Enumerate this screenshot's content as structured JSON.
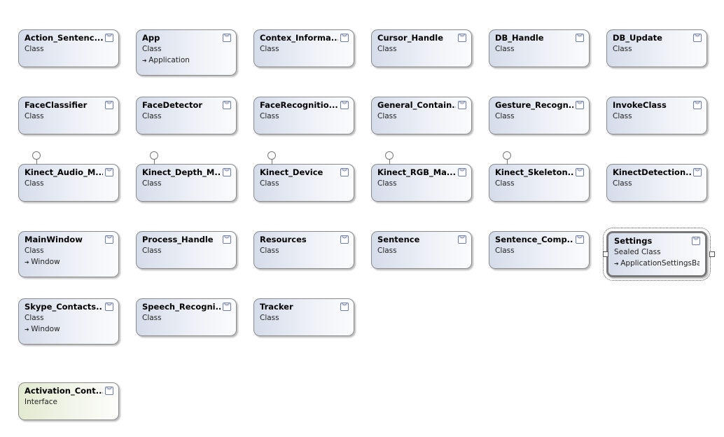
{
  "toggle_icon": "double-chevron-down-icon",
  "arrow_icon": "inheritance-arrow-icon",
  "rows": [
    [
      {
        "name": "Action_Sentenc...",
        "kind": "Class"
      },
      {
        "name": "App",
        "kind": "Class",
        "base": "Application"
      },
      {
        "name": "Contex_Informa...",
        "kind": "Class"
      },
      {
        "name": "Cursor_Handle",
        "kind": "Class"
      },
      {
        "name": "DB_Handle",
        "kind": "Class"
      },
      {
        "name": "DB_Update",
        "kind": "Class"
      }
    ],
    [
      {
        "name": "FaceClassifier",
        "kind": "Class"
      },
      {
        "name": "FaceDetector",
        "kind": "Class"
      },
      {
        "name": "FaceRecognitio...",
        "kind": "Class"
      },
      {
        "name": "General_Contain...",
        "kind": "Class"
      },
      {
        "name": "Gesture_Recogn...",
        "kind": "Class"
      },
      {
        "name": "InvokeClass",
        "kind": "Class"
      }
    ],
    [
      {
        "name": "Kinect_Audio_M...",
        "kind": "Class",
        "lollipop": true
      },
      {
        "name": "Kinect_Depth_M...",
        "kind": "Class",
        "lollipop": true
      },
      {
        "name": "Kinect_Device",
        "kind": "Class",
        "lollipop": true
      },
      {
        "name": "Kinect_RGB_Ma...",
        "kind": "Class",
        "lollipop": true
      },
      {
        "name": "Kinect_Skeleton...",
        "kind": "Class",
        "lollipop": true
      },
      {
        "name": "KinectDetection...",
        "kind": "Class"
      }
    ],
    [
      {
        "name": "MainWindow",
        "kind": "Class",
        "base": "Window"
      },
      {
        "name": "Process_Handle",
        "kind": "Class"
      },
      {
        "name": "Resources",
        "kind": "Class"
      },
      {
        "name": "Sentence",
        "kind": "Class"
      },
      {
        "name": "Sentence_Comp...",
        "kind": "Class"
      },
      {
        "name": "Settings",
        "kind": "Sealed Class",
        "base": "ApplicationSettingsBa...",
        "selected": true
      }
    ],
    [
      {
        "name": "Skype_Contacts...",
        "kind": "Class",
        "base": "Window"
      },
      {
        "name": "Speech_Recogni...",
        "kind": "Class"
      },
      {
        "name": "Tracker",
        "kind": "Class"
      }
    ],
    [
      {
        "name": "Activation_Cont...",
        "kind": "Interface",
        "interface": true
      }
    ]
  ]
}
